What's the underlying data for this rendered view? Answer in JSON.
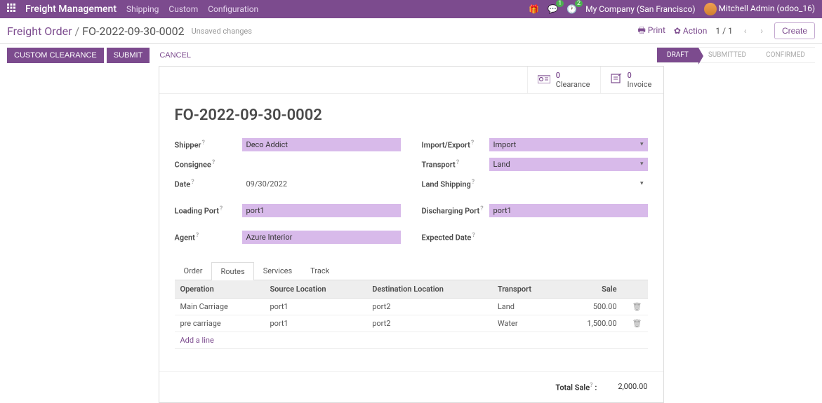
{
  "topnav": {
    "app_name": "Freight Management",
    "links": [
      "Shipping",
      "Custom",
      "Configuration"
    ],
    "msg_badge": "1",
    "clock_badge": "2",
    "company": "My Company (San Francisco)",
    "user": "Mitchell Admin (odoo_16)"
  },
  "breadcrumb": {
    "root": "Freight Order",
    "current": "FO-2022-09-30-0002",
    "unsaved": "Unsaved changes",
    "print": "Print",
    "action": "Action",
    "pager": "1 / 1",
    "create": "Create"
  },
  "actions": {
    "custom_clearance": "CUSTOM CLEARANCE",
    "submit": "SUBMIT",
    "cancel": "CANCEL"
  },
  "status": {
    "draft": "DRAFT",
    "submitted": "SUBMITTED",
    "confirmed": "CONFIRMED"
  },
  "stats": {
    "clearance_count": "0",
    "clearance_label": "Clearance",
    "invoice_count": "0",
    "invoice_label": "Invoice"
  },
  "record": {
    "title": "FO-2022-09-30-0002",
    "labels": {
      "shipper": "Shipper",
      "consignee": "Consignee",
      "date": "Date",
      "loading_port": "Loading Port",
      "agent": "Agent",
      "import_export": "Import/Export",
      "transport": "Transport",
      "land_shipping": "Land Shipping",
      "discharging_port": "Discharging Port",
      "expected_date": "Expected Date"
    },
    "values": {
      "shipper": "Deco Addict",
      "consignee": "",
      "date": "09/30/2022",
      "loading_port": "port1",
      "agent": "Azure Interior",
      "import_export": "Import",
      "transport": "Land",
      "land_shipping": "",
      "discharging_port": "port1",
      "expected_date": ""
    }
  },
  "tabs": {
    "order": "Order",
    "routes": "Routes",
    "services": "Services",
    "track": "Track"
  },
  "table": {
    "headers": {
      "operation": "Operation",
      "source": "Source Location",
      "dest": "Destination Location",
      "transport": "Transport",
      "sale": "Sale"
    },
    "rows": [
      {
        "operation": "Main Carriage",
        "source": "port1",
        "dest": "port2",
        "transport": "Land",
        "sale": "500.00"
      },
      {
        "operation": "pre carriage",
        "source": "port1",
        "dest": "port2",
        "transport": "Water",
        "sale": "1,500.00"
      }
    ],
    "add_line": "Add a line"
  },
  "totals": {
    "label": "Total Sale",
    "value": "2,000.00"
  }
}
